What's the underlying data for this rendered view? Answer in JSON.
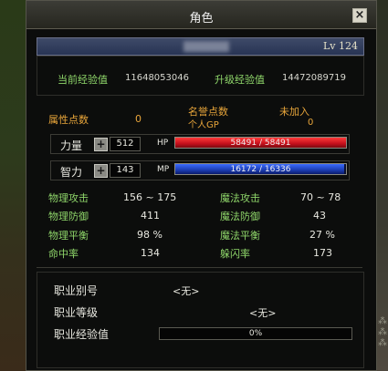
{
  "window": {
    "title": "角色"
  },
  "character": {
    "level": "Lv 124"
  },
  "experience": {
    "current_label": "当前经验值",
    "current_value": "11648053046",
    "next_label": "升级经验值",
    "next_value": "14472089719"
  },
  "points": {
    "attr_points_label": "属性点数",
    "attr_points_value": "0",
    "honor_label": "名誉点数",
    "honor_value": "未加入",
    "gp_label": "个人GP",
    "gp_value": "0"
  },
  "strength": {
    "label": "力量",
    "value": "512",
    "bar_label": "HP",
    "bar_text": "58491 / 58491",
    "bar_fraction": 1.0,
    "bar_color": "#c4101c"
  },
  "intelligence": {
    "label": "智力",
    "value": "143",
    "bar_label": "MP",
    "bar_text": "16172 / 16336",
    "bar_fraction": 0.99,
    "bar_color": "#1c3cb0"
  },
  "attributes": {
    "phys_atk_label": "物理攻击",
    "phys_atk_value": "156 ~ 175",
    "mag_atk_label": "魔法攻击",
    "mag_atk_value": "70 ~ 78",
    "phys_def_label": "物理防御",
    "phys_def_value": "411",
    "mag_def_label": "魔法防御",
    "mag_def_value": "43",
    "phys_bal_label": "物理平衡",
    "phys_bal_value": "98 %",
    "mag_bal_label": "魔法平衡",
    "mag_bal_value": "27 %",
    "hit_label": "命中率",
    "hit_value": "134",
    "dodge_label": "躲闪率",
    "dodge_value": "173"
  },
  "job": {
    "alias_label": "职业别号",
    "alias_value": "<无>",
    "level_label": "职业等级",
    "level_value": "<无>",
    "exp_label": "职业经验值",
    "exp_text": "0%",
    "exp_fraction": 0.0
  },
  "colors": {
    "label_green": "#8fd66a",
    "label_gold": "#e8a53a",
    "hp_red": "#c4101c",
    "mp_blue": "#1c3cb0"
  },
  "icons": {
    "close": "close-icon",
    "plus": "plus-icon"
  }
}
